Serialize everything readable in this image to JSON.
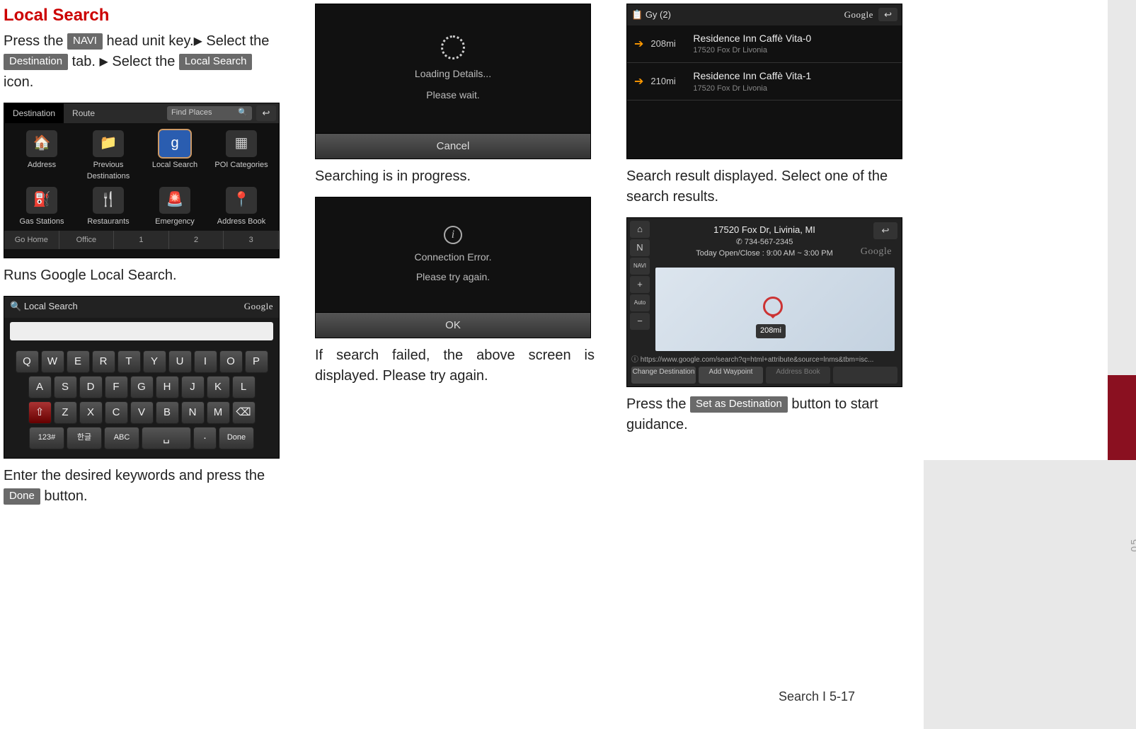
{
  "section_title": "Local Search",
  "intro": {
    "press_the": "Press the ",
    "navi_btn": "NAVI",
    "head_key": " head unit key.",
    "select_the": " Select the ",
    "dest_btn": "Destination",
    "tab": " tab. ",
    "select_the2": " Select the ",
    "local_btn": "Local Search",
    "icon": " icon."
  },
  "caption_runs": "Runs Google Local Search.",
  "caption_enter_1": "Enter the desired keywords and press the ",
  "done_btn": "Done",
  "caption_enter_2": " button.",
  "caption_searching": "Searching is in progress.",
  "caption_fail": "If search failed, the above screen is displayed. Please try again.",
  "caption_results": "Search result displayed. Select one of the search results.",
  "caption_setdest_1": "Press the ",
  "setdest_btn": "Set as Destination",
  "caption_setdest_2": " button to start guidance.",
  "footer": "Search I 5-17",
  "side_page": "05",
  "ss_dest": {
    "tabs": [
      "Destination",
      "Route"
    ],
    "find": "Find Places",
    "cells": [
      "Address",
      "Previous Destinations",
      "Local Search",
      "POI Categories",
      "Gas Stations",
      "Restaurants",
      "Emergency",
      "Address Book"
    ],
    "bottom": [
      "Go Home",
      "Office",
      "1",
      "2",
      "3"
    ]
  },
  "ss_kb": {
    "title": "Local Search",
    "google": "Google",
    "row1": [
      "Q",
      "W",
      "E",
      "R",
      "T",
      "Y",
      "U",
      "I",
      "O",
      "P"
    ],
    "row2": [
      "A",
      "S",
      "D",
      "F",
      "G",
      "H",
      "J",
      "K",
      "L"
    ],
    "row3": [
      "⇧",
      "Z",
      "X",
      "C",
      "V",
      "B",
      "N",
      "M",
      "⌫"
    ],
    "row4": [
      "123#",
      "한글",
      "ABC",
      "␣",
      "·",
      "Done"
    ]
  },
  "ss_load": {
    "line1": "Loading Details...",
    "line2": "Please wait.",
    "cancel": "Cancel"
  },
  "ss_err": {
    "line1": "Connection Error.",
    "line2": "Please try again.",
    "ok": "OK"
  },
  "ss_res": {
    "hdr_left": "Gy (2)",
    "hdr_right": "Google",
    "rows": [
      {
        "dist": "208mi",
        "name": "Residence Inn Caffè Vita-0",
        "addr": "17520 Fox Dr Livonia"
      },
      {
        "dist": "210mi",
        "name": "Residence Inn Caffè Vita-1",
        "addr": "17520 Fox Dr Livonia"
      }
    ]
  },
  "ss_map": {
    "addr": "17520 Fox Dr, Livinia, MI",
    "phone": "734-567-2345",
    "hours": "Today Open/Close : 9:00 AM ~ 3:00 PM",
    "dist": "208mi",
    "url": "https://www.google.com/search?q=html+attribute&source=lnms&tbm=isc...",
    "google": "Google",
    "btns": [
      "Change Destination",
      "Add Waypoint",
      "Address Book",
      ""
    ]
  }
}
